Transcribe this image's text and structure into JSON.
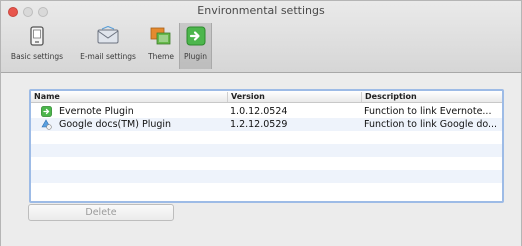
{
  "window": {
    "title": "Environmental settings"
  },
  "toolbar": {
    "items": [
      {
        "label": "Basic settings",
        "icon": "phone-icon"
      },
      {
        "label": "E-mail settings",
        "icon": "envelope-icon"
      },
      {
        "label": "Theme",
        "icon": "palette-icon"
      },
      {
        "label": "Plugin",
        "icon": "plugin-icon",
        "selected": true
      }
    ]
  },
  "table": {
    "columns": [
      "Name",
      "Version",
      "Description"
    ],
    "rows": [
      {
        "name": "Evernote Plugin",
        "version": "1.0.12.0524",
        "description": "Function to link Evernote...",
        "icon": "evernote-plugin-icon"
      },
      {
        "name": "Google docs(TM) Plugin",
        "version": "1.2.12.0529",
        "description": "Function to link Google do...",
        "icon": "google-docs-plugin-icon"
      }
    ]
  },
  "actions": {
    "delete_label": "Delete"
  },
  "colors": {
    "accent_green": "#4cb64c",
    "selection_border": "#9dbbe6",
    "close_red": "#e8564d"
  }
}
